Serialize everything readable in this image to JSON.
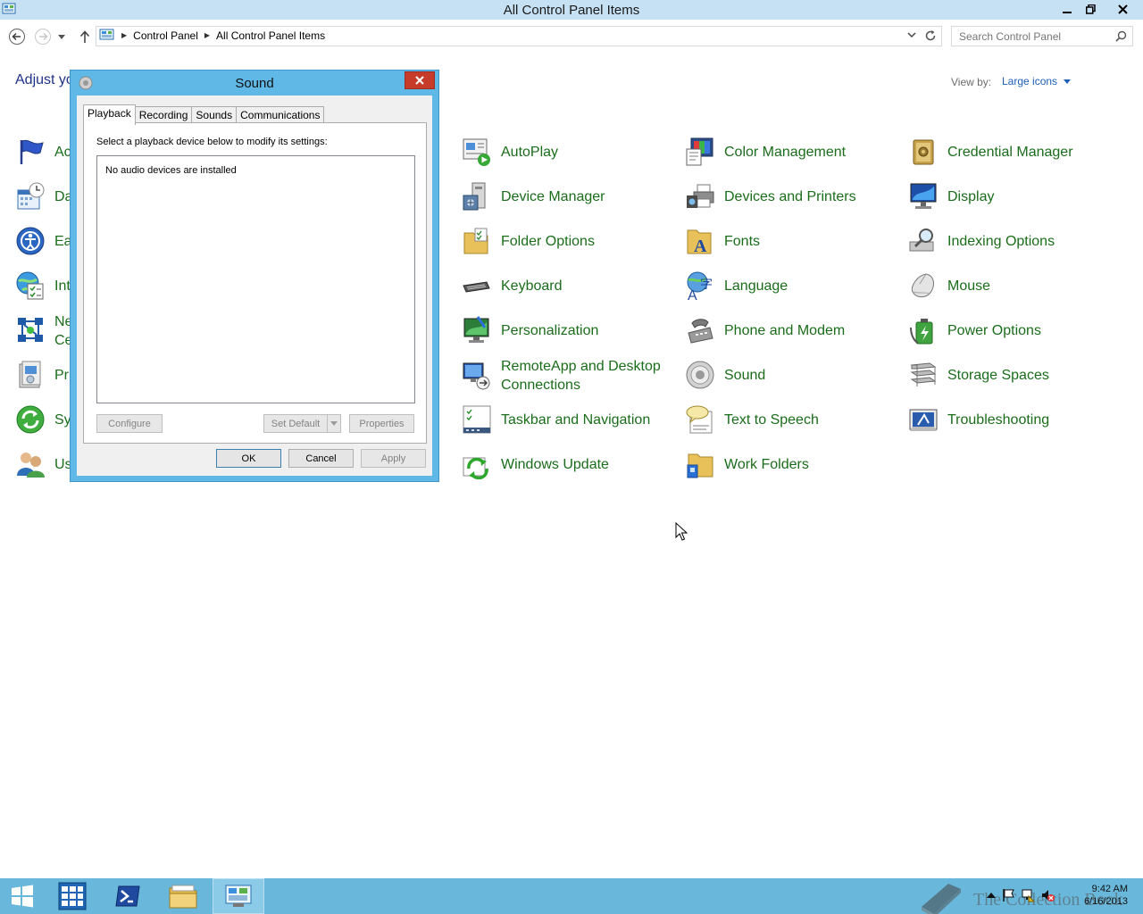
{
  "window": {
    "title": "All Control Panel Items"
  },
  "address": {
    "crumbs": [
      "Control Panel",
      "All Control Panel Items"
    ]
  },
  "search": {
    "placeholder": "Search Control Panel"
  },
  "main": {
    "heading_partial": "Adjust yo",
    "view_by_label": "View by:",
    "view_by_value": "Large icons",
    "left_column_partial": [
      "Ac",
      "Da",
      "Ea",
      "Int",
      "Ne",
      "Ce",
      "Pr",
      "Sy",
      "Us"
    ],
    "items": [
      {
        "label": "AutoPlay",
        "icon": "autoplay-icon"
      },
      {
        "label": "Color Management",
        "icon": "color-management-icon"
      },
      {
        "label": "Credential Manager",
        "icon": "credential-manager-icon"
      },
      {
        "label": "Device Manager",
        "icon": "device-manager-icon"
      },
      {
        "label": "Devices and Printers",
        "icon": "devices-printers-icon"
      },
      {
        "label": "Display",
        "icon": "display-icon"
      },
      {
        "label": "Folder Options",
        "icon": "folder-options-icon"
      },
      {
        "label": "Fonts",
        "icon": "fonts-icon"
      },
      {
        "label": "Indexing Options",
        "icon": "indexing-options-icon"
      },
      {
        "label": "Keyboard",
        "icon": "keyboard-icon"
      },
      {
        "label": "Language",
        "icon": "language-icon"
      },
      {
        "label": "Mouse",
        "icon": "mouse-icon"
      },
      {
        "label": "Personalization",
        "icon": "personalization-icon"
      },
      {
        "label": "Phone and Modem",
        "icon": "phone-modem-icon"
      },
      {
        "label": "Power Options",
        "icon": "power-options-icon"
      },
      {
        "label": "RemoteApp and Desktop Connections",
        "icon": "remoteapp-icon"
      },
      {
        "label": "Sound",
        "icon": "sound-icon"
      },
      {
        "label": "Storage Spaces",
        "icon": "storage-spaces-icon"
      },
      {
        "label": "Taskbar and Navigation",
        "icon": "taskbar-navigation-icon"
      },
      {
        "label": "Text to Speech",
        "icon": "text-to-speech-icon"
      },
      {
        "label": "Troubleshooting",
        "icon": "troubleshooting-icon"
      },
      {
        "label": "Windows Update",
        "icon": "windows-update-icon"
      },
      {
        "label": "Work Folders",
        "icon": "work-folders-icon"
      }
    ]
  },
  "dialog": {
    "title": "Sound",
    "tabs": [
      "Playback",
      "Recording",
      "Sounds",
      "Communications"
    ],
    "active_tab": "Playback",
    "description": "Select a playback device below to modify its settings:",
    "empty_message": "No audio devices are installed",
    "buttons": {
      "configure": "Configure",
      "set_default": "Set Default",
      "properties": "Properties",
      "ok": "OK",
      "cancel": "Cancel",
      "apply": "Apply"
    }
  },
  "taskbar": {
    "watermark": "The Collection Book",
    "time": "9:42 AM",
    "date": "6/16/2013"
  },
  "colors": {
    "title_bar": "#c7e1f4",
    "dialog_frame": "#5fb8e6",
    "taskbar": "#69b8dc",
    "link_green": "#1a6d1a",
    "heading_blue": "#1e3287"
  }
}
